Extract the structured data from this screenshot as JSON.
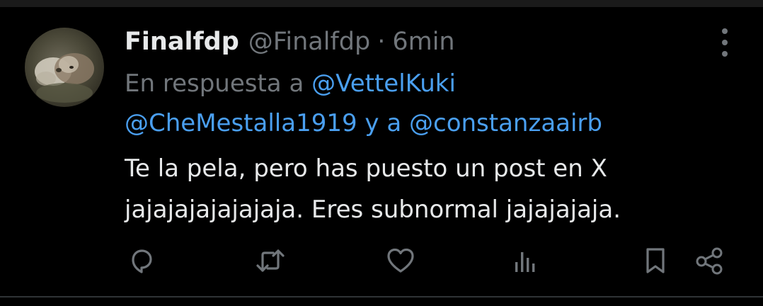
{
  "tweet": {
    "display_name": "Finalfdp",
    "handle": "@Finalfdp",
    "separator": "·",
    "time": "6min",
    "reply_prefix": "En respuesta a",
    "mentions": [
      "@VettelKuki",
      "@CheMestalla1919",
      "@constanzaairb"
    ],
    "reply_joiner": "y a",
    "text_lines": [
      "Te la pela, pero has puesto un post en X",
      "jajajajajajajaja. Eres subnormal jajajajaja."
    ]
  },
  "actions": [
    {
      "name": "reply-icon"
    },
    {
      "name": "repost-icon"
    },
    {
      "name": "like-icon"
    },
    {
      "name": "views-icon"
    },
    {
      "name": "bookmark-icon"
    },
    {
      "name": "share-icon"
    }
  ],
  "colors": {
    "background": "#000000",
    "text": "#e7e9ea",
    "muted": "#71767b",
    "link": "#4a9ff0"
  }
}
